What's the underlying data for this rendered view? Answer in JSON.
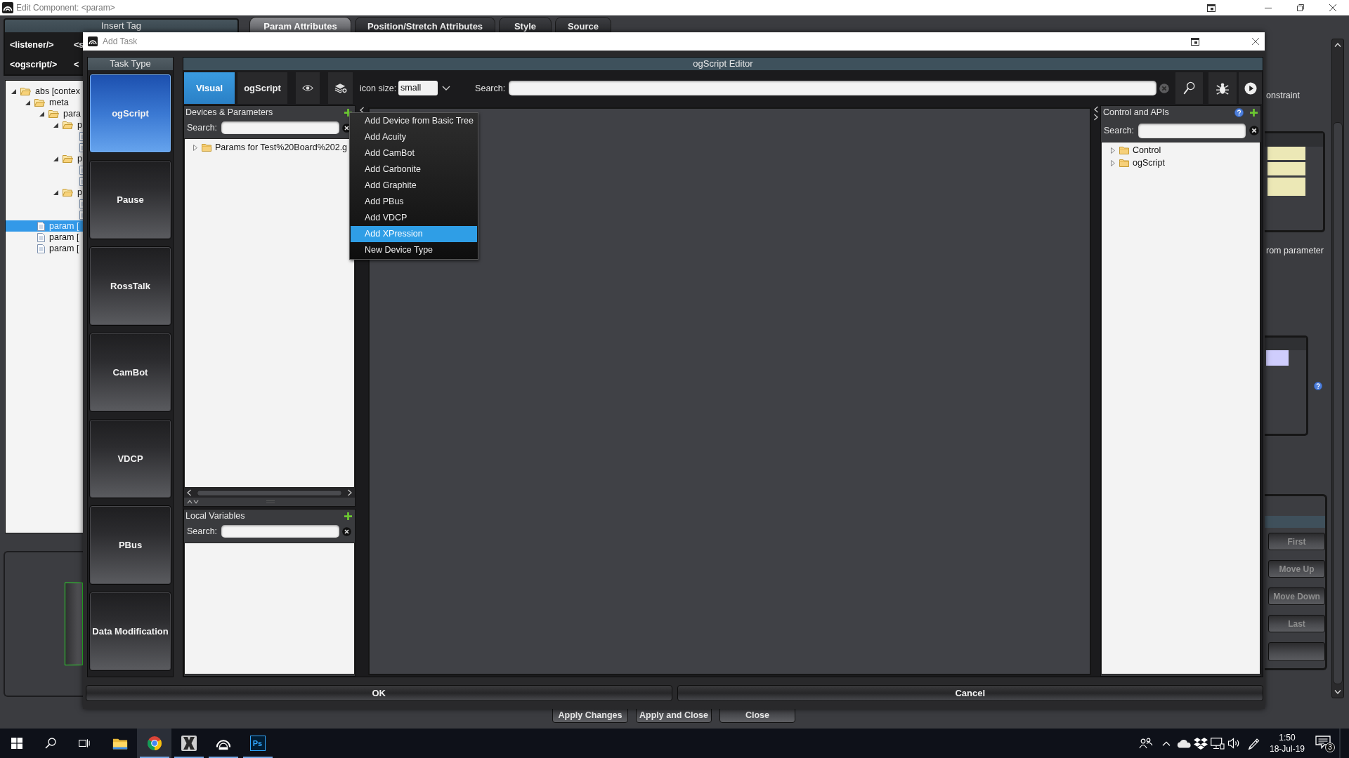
{
  "window": {
    "title": "Edit Component: <param>"
  },
  "insert_tag": {
    "title": "Insert Tag",
    "rows": [
      [
        "<listener/>",
        "<s"
      ],
      [
        "<ogscript/>",
        "<"
      ]
    ]
  },
  "tabs": [
    {
      "label": "Param Attributes",
      "selected": true
    },
    {
      "label": "Position/Stretch Attributes",
      "selected": false
    },
    {
      "label": "Style",
      "selected": false
    },
    {
      "label": "Source",
      "selected": false
    }
  ],
  "component_tree": [
    {
      "label": "abs [contex",
      "kind": "folder",
      "expanded": true,
      "selected": false,
      "children": [
        {
          "label": "meta",
          "kind": "folder",
          "expanded": true,
          "selected": false,
          "children": [
            {
              "label": "para",
              "kind": "folder",
              "expanded": true,
              "selected": false,
              "children": [
                {
                  "label": "p",
                  "kind": "folder",
                  "expanded": true,
                  "selected": false,
                  "children": [
                    {
                      "kind": "file"
                    },
                    {
                      "kind": "file"
                    }
                  ]
                },
                {
                  "label": "p",
                  "kind": "folder",
                  "expanded": true,
                  "selected": false,
                  "children": [
                    {
                      "kind": "file"
                    },
                    {
                      "kind": "file"
                    }
                  ]
                },
                {
                  "label": "p",
                  "kind": "folder",
                  "expanded": true,
                  "selected": false,
                  "children": [
                    {
                      "kind": "file"
                    },
                    {
                      "kind": "file"
                    }
                  ]
                }
              ]
            }
          ]
        },
        {
          "label": "param [",
          "kind": "file",
          "selected": true
        },
        {
          "label": "param [",
          "kind": "file",
          "selected": false
        },
        {
          "label": "param [",
          "kind": "file",
          "selected": false
        }
      ]
    }
  ],
  "side_panel": {
    "labels": [
      "onstraint",
      "rom parameter"
    ],
    "order_buttons": [
      {
        "label": "First",
        "disabled": true
      },
      {
        "label": "Move Up",
        "disabled": true
      },
      {
        "label": "Move Down",
        "disabled": true
      },
      {
        "label": "Last",
        "disabled": true
      }
    ]
  },
  "footer_buttons": [
    "Apply Changes",
    "Apply and Close",
    "Close"
  ],
  "dialog": {
    "title": "Add Task",
    "task_type": {
      "title": "Task Type",
      "items": [
        {
          "label": "ogScript",
          "selected": true
        },
        {
          "label": "Pause",
          "selected": false
        },
        {
          "label": "RossTalk",
          "selected": false
        },
        {
          "label": "CamBot",
          "selected": false
        },
        {
          "label": "VDCP",
          "selected": false
        },
        {
          "label": "PBus",
          "selected": false
        },
        {
          "label": "Data Modification",
          "selected": false
        }
      ]
    },
    "editor": {
      "title": "ogScript Editor",
      "modes": [
        {
          "label": "Visual",
          "selected": true
        },
        {
          "label": "ogScript",
          "selected": false
        }
      ],
      "icon_size": {
        "label": "icon size:",
        "value": "small"
      },
      "search": {
        "label": "Search:"
      },
      "devices": {
        "title": "Devices & Parameters",
        "search_label": "Search:",
        "tree": [
          {
            "label": "Params for Test%20Board%202.g",
            "expanded": false,
            "selected": false
          }
        ]
      },
      "add_menu": [
        {
          "label": "Add Device from Basic Tree",
          "selected": false
        },
        {
          "label": "Add Acuity",
          "selected": false
        },
        {
          "label": "Add CamBot",
          "selected": false
        },
        {
          "label": "Add Carbonite",
          "selected": false
        },
        {
          "label": "Add Graphite",
          "selected": false
        },
        {
          "label": "Add PBus",
          "selected": false
        },
        {
          "label": "Add VDCP",
          "selected": false
        },
        {
          "label": "Add XPression",
          "selected": true
        },
        {
          "label": "New Device Type",
          "selected": false
        }
      ],
      "local_variables": {
        "title": "Local Variables",
        "search_label": "Search:"
      },
      "apis": {
        "title": "Control and APIs",
        "search_label": "Search:",
        "tree": [
          {
            "label": "Control",
            "expanded": false,
            "selected": false
          },
          {
            "label": "ogScript",
            "expanded": false,
            "selected": false
          }
        ]
      }
    },
    "buttons": [
      "OK",
      "Cancel"
    ]
  },
  "taskbar": {
    "apps": [
      {
        "kind": "files",
        "running": false,
        "selected": false
      },
      {
        "kind": "browser",
        "running": true,
        "selected": true
      },
      {
        "kind": "graphics",
        "running": true,
        "selected": false
      },
      {
        "kind": "dashboard",
        "running": true,
        "selected": false
      },
      {
        "kind": "design",
        "label": "Ps",
        "running": true,
        "selected": false
      }
    ],
    "clock": {
      "time": "1:50",
      "date": "18-Jul-19"
    },
    "notifications": "3"
  }
}
